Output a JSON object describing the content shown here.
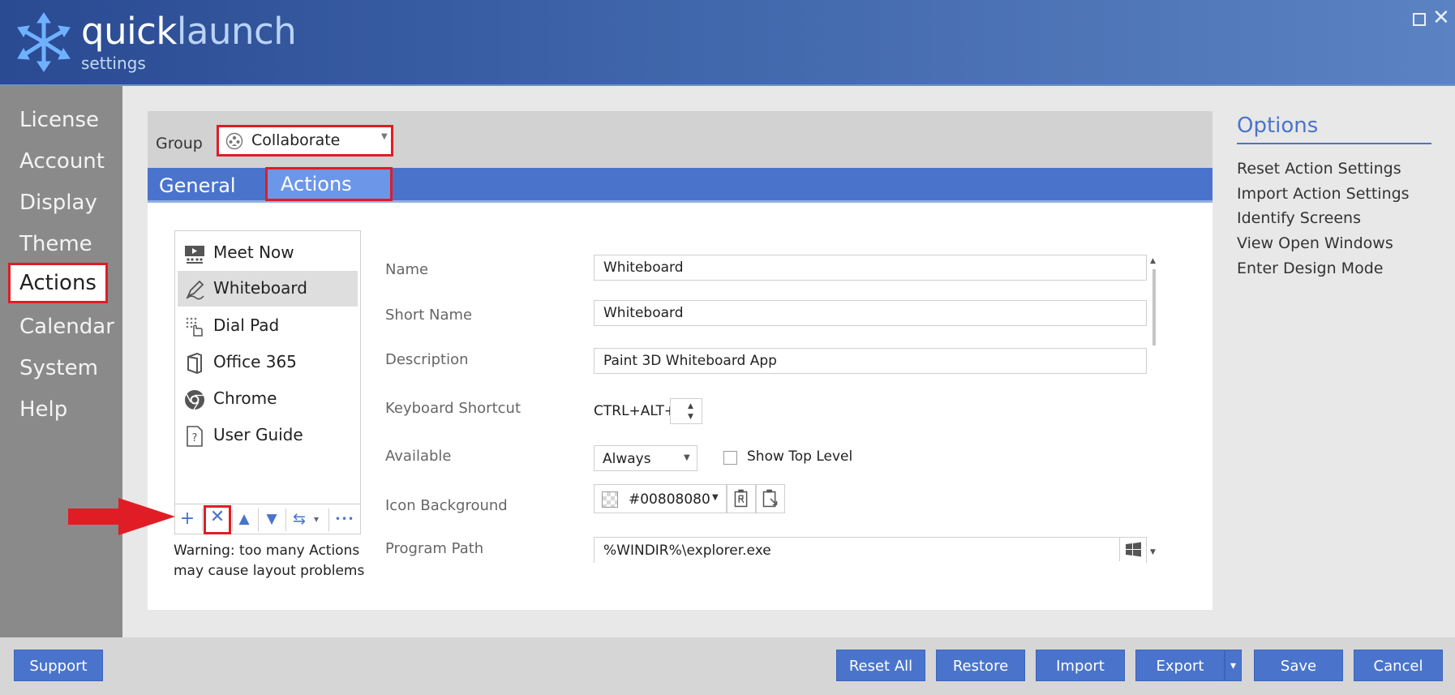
{
  "app": {
    "brand_part1": "quick",
    "brand_part2": "launch",
    "subtitle": "settings"
  },
  "window_controls": {
    "maximize": "maximize-icon",
    "close": "✕"
  },
  "sidebar": {
    "items": [
      {
        "label": "License"
      },
      {
        "label": "Account"
      },
      {
        "label": "Display"
      },
      {
        "label": "Theme"
      },
      {
        "label": "Actions",
        "active": true
      },
      {
        "label": "Calendar"
      },
      {
        "label": "System"
      },
      {
        "label": "Help"
      }
    ]
  },
  "group": {
    "label": "Group",
    "value": "Collaborate",
    "icon": "people-group-icon"
  },
  "tabs": [
    {
      "label": "General"
    },
    {
      "label": "Actions",
      "active": true
    }
  ],
  "actions_list": {
    "items": [
      {
        "label": "Meet Now",
        "icon": "meeting-board-icon"
      },
      {
        "label": "Whiteboard",
        "icon": "pen-icon",
        "selected": true
      },
      {
        "label": "Dial Pad",
        "icon": "dialpad-icon"
      },
      {
        "label": "Office 365",
        "icon": "office-icon"
      },
      {
        "label": "Chrome",
        "icon": "chrome-icon"
      },
      {
        "label": "User Guide",
        "icon": "question-doc-icon"
      }
    ],
    "toolbar": {
      "add": "+",
      "remove": "✕",
      "up": "▲",
      "down": "▼",
      "swap": "⇆",
      "dropdown": "▾",
      "more": "•••"
    },
    "warning": "Warning: too many Actions may cause layout problems"
  },
  "form": {
    "name": {
      "label": "Name",
      "value": "Whiteboard"
    },
    "short_name": {
      "label": "Short Name",
      "value": "Whiteboard"
    },
    "description": {
      "label": "Description",
      "value": "Paint 3D Whiteboard App"
    },
    "keyboard_shortcut": {
      "label": "Keyboard Shortcut",
      "prefix": "CTRL+ALT+"
    },
    "available": {
      "label": "Available",
      "value": "Always"
    },
    "show_top_level": {
      "label": "Show Top Level",
      "checked": false
    },
    "icon_background": {
      "label": "Icon Background",
      "value": "#00808080"
    },
    "program_path": {
      "label": "Program Path",
      "value": "%WINDIR%\\explorer.exe"
    }
  },
  "options": {
    "title": "Options",
    "links": [
      "Reset Action Settings",
      "Import Action Settings",
      "Identify Screens",
      "View Open Windows",
      "Enter Design Mode"
    ]
  },
  "footer": {
    "support": "Support",
    "reset_all": "Reset All",
    "restore": "Restore",
    "import": "Import",
    "export": "Export",
    "export_dropdown": "▾",
    "save": "Save",
    "cancel": "Cancel"
  },
  "colors": {
    "header": "#3f65aa",
    "accent": "#4a74cc",
    "sidebar": "#8a8a8a",
    "highlight": "#e01d24"
  }
}
